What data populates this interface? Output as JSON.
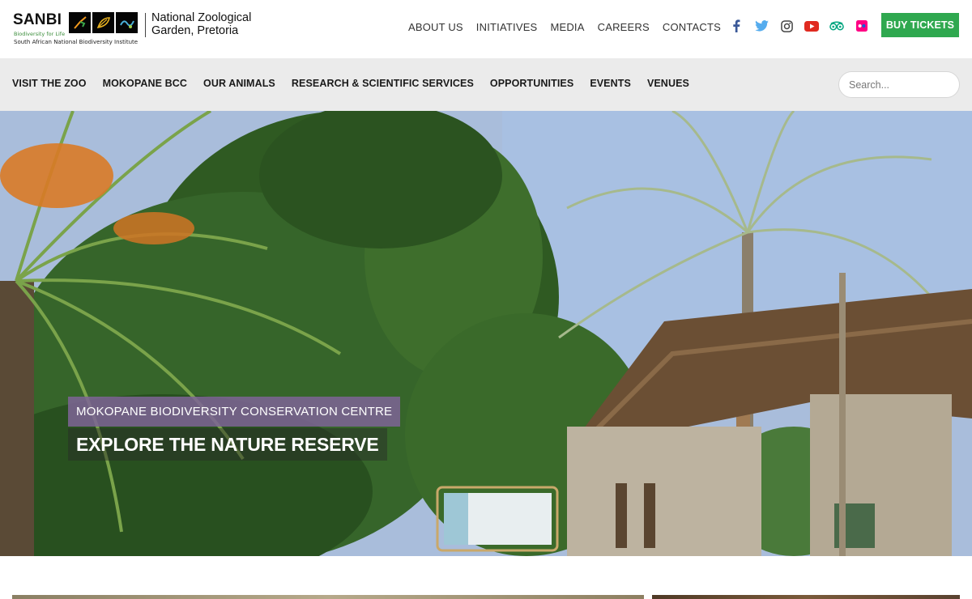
{
  "header": {
    "logo": {
      "brand": "SANBI",
      "tagline": "Biodiversity for Life",
      "institute": "South African National Biodiversity Institute"
    },
    "zoo_name_line1": "National Zoological",
    "zoo_name_line2": "Garden, Pretoria",
    "top_nav": [
      "ABOUT US",
      "INITIATIVES",
      "MEDIA",
      "CAREERS",
      "CONTACTS"
    ],
    "socials": [
      {
        "icon": "facebook-icon",
        "color": "#3b5998"
      },
      {
        "icon": "twitter-icon",
        "color": "#55acee"
      },
      {
        "icon": "instagram-icon",
        "color": "#444444"
      },
      {
        "icon": "youtube-icon",
        "color": "#e02a20"
      },
      {
        "icon": "tripadvisor-icon",
        "color": "#00a680"
      },
      {
        "icon": "flickr-icon",
        "color": "#ff0084"
      }
    ],
    "buy_tickets": "BUY TICKETS",
    "buy_color": "#2fa84f"
  },
  "main_nav": {
    "items": [
      "VISIT THE ZOO",
      "MOKOPANE BCC",
      "OUR ANIMALS",
      "RESEARCH & SCIENTIFIC SERVICES",
      "OPPORTUNITIES",
      "EVENTS",
      "VENUES"
    ],
    "search_placeholder": "Search..."
  },
  "hero": {
    "subtitle": "MOKOPANE BIODIVERSITY CONSERVATION CENTRE",
    "title": "EXPLORE THE NATURE RESERVE",
    "subtitle_bg": "#7e6496"
  }
}
